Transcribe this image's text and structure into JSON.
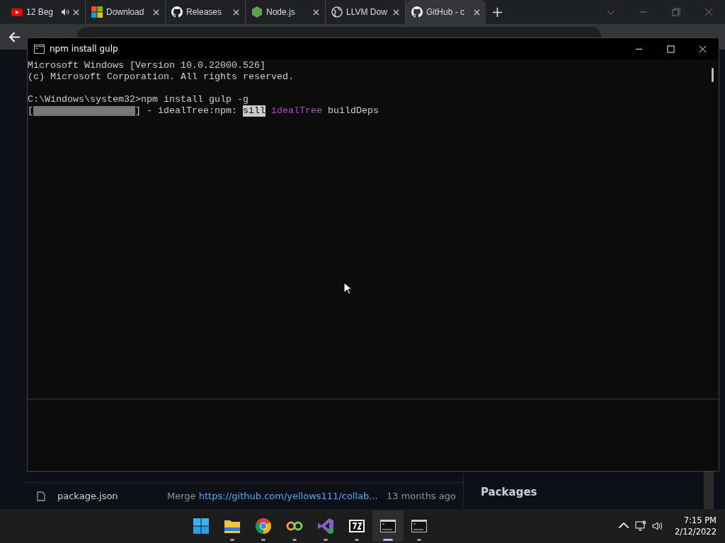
{
  "browser": {
    "tabs": [
      {
        "title": "12 Beg",
        "kind": "youtube",
        "audio": true,
        "selected": false
      },
      {
        "title": "Download",
        "kind": "windows",
        "audio": false,
        "selected": false
      },
      {
        "title": "Releases",
        "kind": "github",
        "audio": false,
        "selected": false
      },
      {
        "title": "Node.js",
        "kind": "node",
        "audio": false,
        "selected": false
      },
      {
        "title": "LLVM Dow",
        "kind": "globe",
        "audio": false,
        "selected": false
      },
      {
        "title": "GitHub - c",
        "kind": "github",
        "audio": false,
        "selected": true
      }
    ]
  },
  "page": {
    "files": [
      {
        "name": "package.json",
        "message": "Merge ",
        "link": "https://github.com/yellows111/collab...",
        "time": "13 months ago"
      }
    ],
    "side_heading": "Packages"
  },
  "terminal": {
    "title": "npm install gulp",
    "blocks": [
      {
        "lines": [
          {
            "segments": [
              {
                "kind": "text",
                "text": "Microsoft Windows [Version 10.0.22000.526]"
              }
            ]
          },
          {
            "segments": [
              {
                "kind": "text",
                "text": "(c) Microsoft Corporation. All rights reserved."
              }
            ]
          }
        ]
      },
      {
        "lines": [
          {
            "segments": [
              {
                "kind": "text",
                "text": "C:\\Windows\\system32>npm install gulp -g"
              }
            ]
          },
          {
            "segments": [
              {
                "kind": "text",
                "text": "["
              },
              {
                "kind": "progress"
              },
              {
                "kind": "text",
                "text": "] - idealTree:npm: "
              },
              {
                "kind": "highlight",
                "text": "sill"
              },
              {
                "kind": "magenta",
                "text": " idealTree"
              },
              {
                "kind": "text",
                "text": " buildDeps"
              }
            ]
          }
        ]
      }
    ]
  },
  "taskbar": {
    "apps": [
      {
        "kind": "start",
        "running": false,
        "active": false
      },
      {
        "kind": "folder",
        "running": true,
        "active": false
      },
      {
        "kind": "chrome",
        "running": true,
        "active": false
      },
      {
        "kind": "infinity",
        "running": true,
        "active": false
      },
      {
        "kind": "studio",
        "running": true,
        "active": false
      },
      {
        "kind": "zip",
        "running": true,
        "active": false
      },
      {
        "kind": "console",
        "running": true,
        "active": true
      },
      {
        "kind": "console",
        "running": true,
        "active": false
      }
    ],
    "time": "7:15 PM",
    "date": "2/12/2022"
  }
}
